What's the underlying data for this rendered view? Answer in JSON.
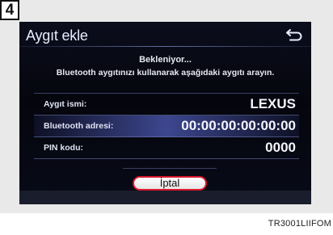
{
  "step_number": "4",
  "screen": {
    "title": "Aygıt ekle",
    "status": "Bekleniyor...",
    "instruction": "Bluetooth aygıtınızı kullanarak aşağıdaki aygıtı arayın."
  },
  "info_rows": [
    {
      "label": "Aygıt ismi:",
      "value": "LEXUS"
    },
    {
      "label": "Bluetooth adresi:",
      "value": "00:00:00:00:00:00"
    },
    {
      "label": "PIN kodu:",
      "value": "0000"
    }
  ],
  "buttons": {
    "cancel_label": "İptal"
  },
  "icons": {
    "back": "back-arrow-icon"
  },
  "caption": "TR3001LIIFOM",
  "colors": {
    "screen_background": "#05060d",
    "highlight": "#5a69d2",
    "cancel_border": "#d8162a"
  }
}
